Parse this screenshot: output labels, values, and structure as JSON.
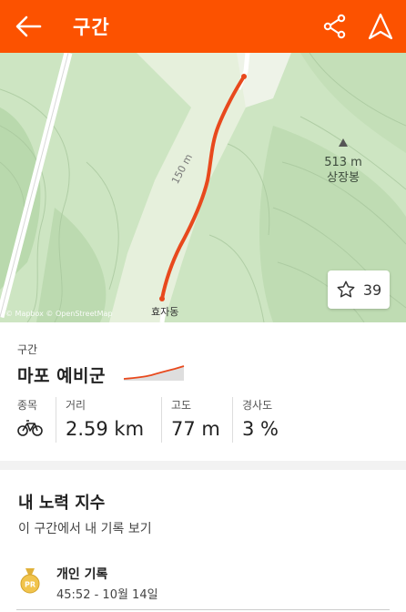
{
  "header": {
    "title": "구간",
    "back_icon": "back-arrow-icon",
    "share_icon": "share-icon",
    "navigate_icon": "navigation-arrow-icon",
    "background_color": "#fc5200"
  },
  "map": {
    "peak_elevation": "513 m",
    "peak_name": "상장봉",
    "town_label": "효자동",
    "distance_marker": "150 m",
    "attribution": "© Mapbox © OpenStreetMap",
    "star_count": "39",
    "route_color": "#e8491d"
  },
  "segment": {
    "kicker": "구간",
    "name": "마포 예비군",
    "stats": {
      "sport_label": "종목",
      "sport_icon": "bicycle-icon",
      "distance_label": "거리",
      "distance_value": "2.59 km",
      "elevation_label": "고도",
      "elevation_value": "77 m",
      "grade_label": "경사도",
      "grade_value": "3 %"
    }
  },
  "effort": {
    "title": "내 노력 지수",
    "subtitle": "이 구간에서 내 기록 보기",
    "pr_badge": "PR",
    "pr_title": "개인 기록",
    "pr_detail": "45:52 - 10월 14일"
  }
}
